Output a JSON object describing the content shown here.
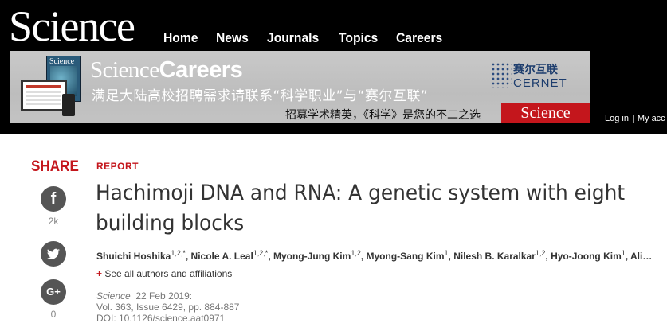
{
  "header": {
    "logo": "Science",
    "nav": [
      "Home",
      "News",
      "Journals",
      "Topics",
      "Careers"
    ],
    "login": "Log in",
    "my_account": "My acc"
  },
  "banner": {
    "magazine_title": "Science",
    "title_bold": "Science",
    "title_rest": "Careers",
    "subtitle": "满足大陆高校招聘需求请联系“科学职业”与“赛尔互联”",
    "subtitle2": "招募学术精英，《科学》是您的不二之选",
    "cernet_cn": "赛尔互联",
    "cernet_en": "CERNET",
    "badge": "Science"
  },
  "share": {
    "label": "SHARE",
    "facebook_count": "2k",
    "googleplus_count": "0"
  },
  "article": {
    "type": "REPORT",
    "title_line1": "Hachimoji DNA and RNA: A genetic system with eight",
    "title_line2": "building blocks",
    "authors": [
      {
        "name": "Shuichi Hoshika",
        "aff": "1,2,*"
      },
      {
        "name": "Nicole A. Leal",
        "aff": "1,2,*"
      },
      {
        "name": "Myong-Jung Kim",
        "aff": "1,2"
      },
      {
        "name": "Myong-Sang Kim",
        "aff": "1"
      },
      {
        "name": "Nilesh B. Karalkar",
        "aff": "1,2"
      },
      {
        "name": "Hyo-Joong Kim",
        "aff": "1"
      },
      {
        "name": "Ali…",
        "aff": ""
      }
    ],
    "see_all": "See all authors and affiliations",
    "journal": "Science",
    "date": "22 Feb 2019:",
    "volume": "Vol. 363, Issue 6429, pp. 884-887",
    "doi": "DOI: 10.1126/science.aat0971"
  },
  "colors": {
    "brand_red": "#c4161c",
    "header_bg": "#000000",
    "share_icon_bg": "#555555"
  },
  "icons": [
    "facebook-icon",
    "twitter-icon",
    "google-plus-icon"
  ]
}
